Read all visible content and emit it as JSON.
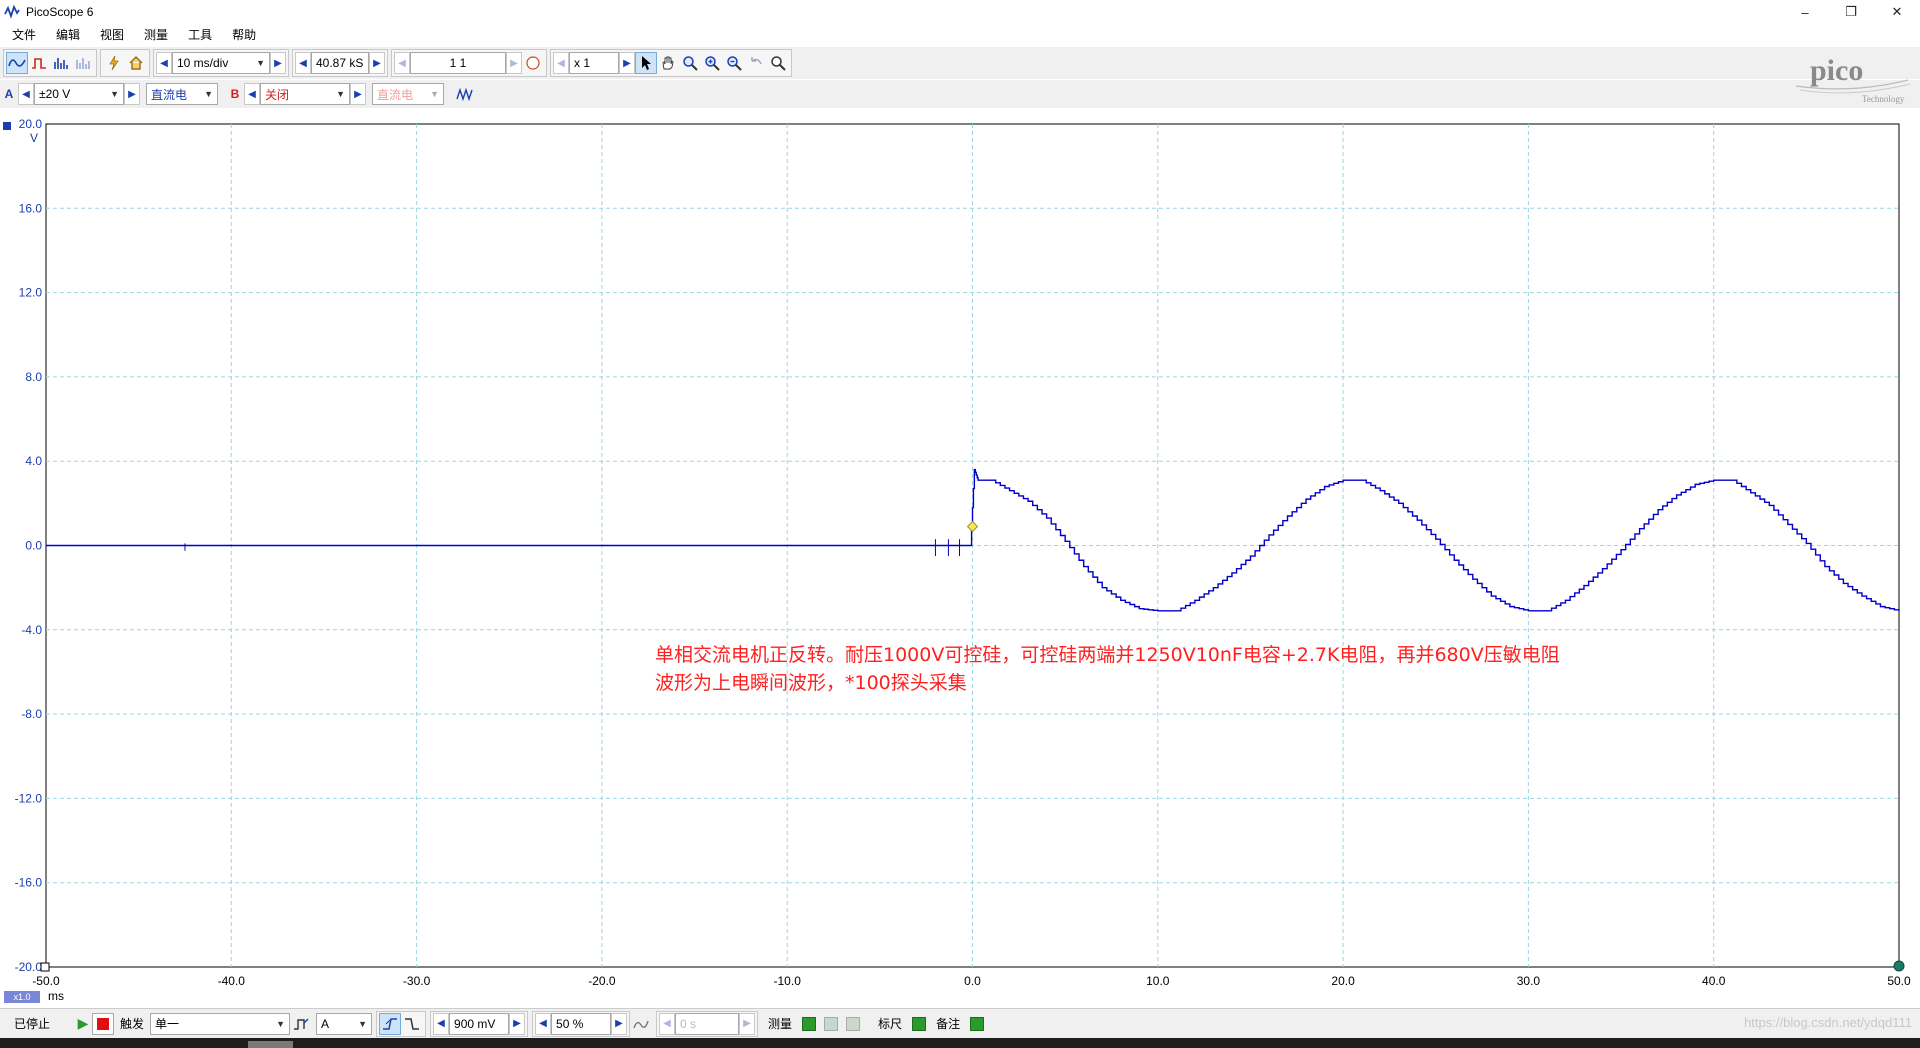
{
  "window": {
    "title": "PicoScope 6",
    "min": "–",
    "restore": "❐",
    "close": "✕"
  },
  "menu": [
    "文件",
    "编辑",
    "视图",
    "测量",
    "工具",
    "帮助"
  ],
  "toolbar": {
    "timebase": "10 ms/div",
    "samples": "40.87 kS",
    "buffer": "1 1",
    "zoom": "x 1"
  },
  "channels": {
    "a_label": "A",
    "a_range": "±20 V",
    "a_coupling": "直流电",
    "b_label": "B",
    "b_range": "关闭",
    "b_coupling": "直流电"
  },
  "logo": {
    "text": "pico",
    "sub": "Technology"
  },
  "chart_data": {
    "type": "line",
    "xlabel": "ms",
    "ylabel": "V",
    "xlim": [
      -50,
      50
    ],
    "ylim": [
      -20,
      20
    ],
    "x_ticks": [
      "-50.0",
      "-40.0",
      "-30.0",
      "-20.0",
      "-10.0",
      "0.0",
      "10.0",
      "20.0",
      "30.0",
      "40.0",
      "50.0"
    ],
    "y_ticks": [
      "20.0",
      "16.0",
      "12.0",
      "8.0",
      "4.0",
      "0.0",
      "-4.0",
      "-8.0",
      "-12.0",
      "-16.0",
      "-20.0"
    ],
    "grid": true,
    "trigger": {
      "x": 0,
      "y": 0.9
    },
    "series": [
      {
        "color": "#0000c8",
        "points": [
          [
            -50,
            0
          ],
          [
            -2.0,
            0
          ],
          [
            -0.1,
            0
          ],
          [
            0.1,
            3.6
          ],
          [
            0.3,
            3.1
          ],
          [
            1.0,
            3.1
          ],
          [
            2,
            2.6
          ],
          [
            3,
            2.1
          ],
          [
            4,
            1.3
          ],
          [
            5,
            0.2
          ],
          [
            6,
            -1.0
          ],
          [
            7,
            -2.0
          ],
          [
            8,
            -2.6
          ],
          [
            9,
            -3.0
          ],
          [
            10,
            -3.1
          ],
          [
            11,
            -3.1
          ],
          [
            12,
            -2.6
          ],
          [
            13,
            -2.0
          ],
          [
            14,
            -1.3
          ],
          [
            15,
            -0.5
          ],
          [
            16,
            0.5
          ],
          [
            17,
            1.4
          ],
          [
            18,
            2.2
          ],
          [
            19,
            2.8
          ],
          [
            20,
            3.1
          ],
          [
            21,
            3.1
          ],
          [
            22,
            2.6
          ],
          [
            23,
            2.0
          ],
          [
            24,
            1.2
          ],
          [
            25,
            0.3
          ],
          [
            26,
            -0.7
          ],
          [
            27,
            -1.6
          ],
          [
            28,
            -2.4
          ],
          [
            29,
            -2.9
          ],
          [
            30,
            -3.1
          ],
          [
            31,
            -3.1
          ],
          [
            32,
            -2.6
          ],
          [
            33,
            -1.9
          ],
          [
            34,
            -1.1
          ],
          [
            35,
            -0.2
          ],
          [
            36,
            0.8
          ],
          [
            37,
            1.7
          ],
          [
            38,
            2.4
          ],
          [
            39,
            2.9
          ],
          [
            40,
            3.1
          ],
          [
            41,
            3.1
          ],
          [
            42,
            2.5
          ],
          [
            43,
            1.9
          ],
          [
            44,
            1.0
          ],
          [
            45,
            0.1
          ],
          [
            46,
            -1.0
          ],
          [
            47,
            -1.8
          ],
          [
            48,
            -2.4
          ],
          [
            49,
            -2.9
          ],
          [
            50,
            -3.1
          ]
        ]
      }
    ]
  },
  "annotation": {
    "line1": "单相交流电机正反转。耐压1000V可控硅，可控硅两端并1250V10nF电容+2.7K电阻，再并680V压敏电阻",
    "line2": "波形为上电瞬间波形，*100探头采集"
  },
  "axis_unit_x": "ms",
  "axis_unit_y": "V",
  "axis_zoom": "x1.0",
  "status": {
    "state": "已停止",
    "trigger_label": "触发",
    "trigger_mode": "单一",
    "trigger_source": "A",
    "threshold": "900 mV",
    "pretrigger": "50 %",
    "delay": "0 s",
    "measure_label": "测量",
    "ruler_label": "标尺",
    "notes_label": "备注"
  },
  "watermark": "https://blog.csdn.net/ydqd111"
}
